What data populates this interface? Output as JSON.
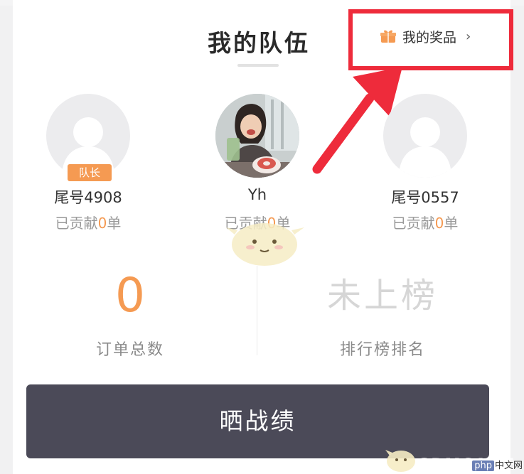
{
  "header": {
    "title": "我的队伍",
    "prize_link": {
      "label": "我的奖品",
      "chevron": "›",
      "icon": "gift-icon"
    }
  },
  "members": [
    {
      "name": "尾号4908",
      "badge": "队长",
      "contrib_prefix": "已贡献",
      "contrib_count": "0",
      "contrib_suffix": "单",
      "avatar": "default-avatar"
    },
    {
      "name": "Yh",
      "contrib_prefix": "已贡献",
      "contrib_count": "0",
      "contrib_suffix": "单",
      "avatar": "photo-avatar"
    },
    {
      "name": "尾号0557",
      "contrib_prefix": "已贡献",
      "contrib_count": "0",
      "contrib_suffix": "单",
      "avatar": "default-avatar"
    }
  ],
  "stats": {
    "orders": {
      "value": "0",
      "label": "订单总数"
    },
    "rank": {
      "value": "未上榜",
      "label": "排行榜排名"
    }
  },
  "share_button": {
    "label": "晒战绩"
  },
  "watermark": {
    "text": "3DMGAME",
    "php": "php",
    "cn": "中文网"
  },
  "colors": {
    "accent": "#f59a52",
    "highlight": "#ee2b3b",
    "button_bg": "#4b4a58",
    "muted": "#d6d6d6"
  }
}
